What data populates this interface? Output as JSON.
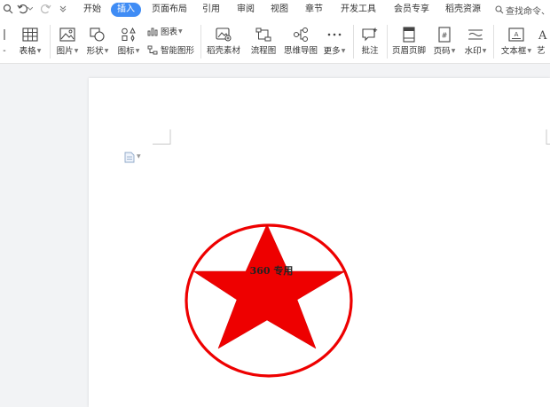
{
  "menubar": {
    "tabs": [
      {
        "label": "开始",
        "active": false
      },
      {
        "label": "插入",
        "active": true
      },
      {
        "label": "页面布局",
        "active": false
      },
      {
        "label": "引用",
        "active": false
      },
      {
        "label": "审阅",
        "active": false
      },
      {
        "label": "视图",
        "active": false
      },
      {
        "label": "章节",
        "active": false
      },
      {
        "label": "开发工具",
        "active": false
      },
      {
        "label": "会员专享",
        "active": false
      },
      {
        "label": "稻壳资源",
        "active": false
      }
    ],
    "search_text": "查找命令、",
    "accent_color": "#3f8cf5"
  },
  "ribbon": {
    "table": "表格",
    "picture": "图片",
    "shape": "形状",
    "icon": "图标",
    "chart": "图表",
    "smart_graphic": "智能图形",
    "daoke_material": "稻壳素材",
    "flowchart": "流程图",
    "mindmap": "思维导图",
    "more": "更多",
    "comment": "批注",
    "header_footer": "页眉页脚",
    "page_number": "页码",
    "watermark": "水印",
    "textbox": "文本框",
    "art_text": "艺"
  },
  "document": {
    "seal_text": "360 专用",
    "seal_color": "#ee0000"
  }
}
